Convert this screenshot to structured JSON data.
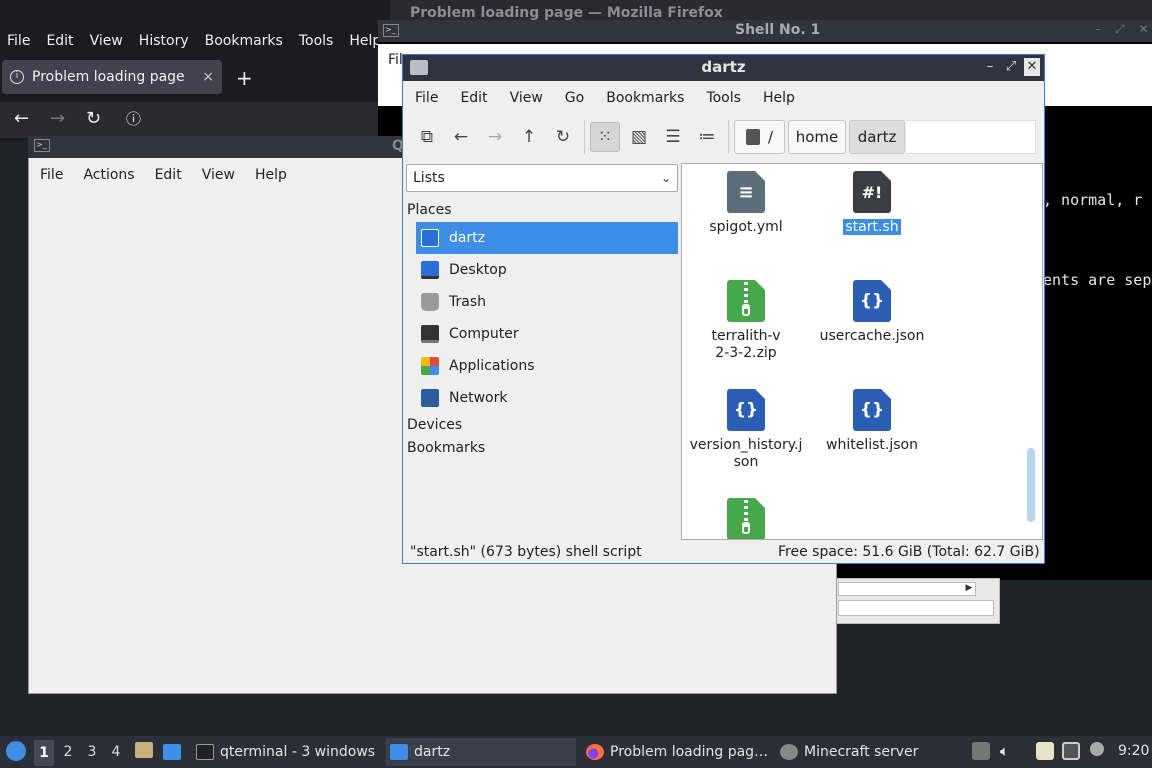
{
  "firefox": {
    "window_title": "Problem loading page — Mozilla Firefox",
    "menu": [
      "File",
      "Edit",
      "View",
      "History",
      "Bookmarks",
      "Tools",
      "Help"
    ],
    "tab_title": "Problem loading page",
    "tab_close": "×",
    "new_tab": "+"
  },
  "shell": {
    "window_title": "Shell No. 1",
    "menu_first": "Fil",
    "term_line_1": ", normal, r",
    "term_line_2": "ents are sep"
  },
  "qterminal": {
    "title_char": "Q",
    "menu": [
      "File",
      "Actions",
      "Edit",
      "View",
      "Help"
    ]
  },
  "file_manager": {
    "window_title": "dartz",
    "menu": [
      "File",
      "Edit",
      "View",
      "Go",
      "Bookmarks",
      "Tools",
      "Help"
    ],
    "breadcrumb": [
      "/",
      "home",
      "dartz"
    ],
    "side_pane_mode": "Lists",
    "places_header": "Places",
    "places": [
      {
        "label": "dartz",
        "icon": "home-folder-icon",
        "color": "#3d8ee6"
      },
      {
        "label": "Desktop",
        "icon": "desktop-icon",
        "color": "#2a6fd6"
      },
      {
        "label": "Trash",
        "icon": "trash-icon",
        "color": "#9a9a9a"
      },
      {
        "label": "Computer",
        "icon": "computer-icon",
        "color": "#333333"
      },
      {
        "label": "Applications",
        "icon": "applications-icon",
        "color": "#e64a3d"
      },
      {
        "label": "Network",
        "icon": "network-icon",
        "color": "#2d5d9e"
      }
    ],
    "devices_header": "Devices",
    "bookmarks_header": "Bookmarks",
    "files": [
      {
        "name": "spigot.yml",
        "type": "text"
      },
      {
        "name": "start.sh",
        "type": "sh",
        "selected": true
      },
      {
        "name": "terralith-v2-3-2.zip",
        "type": "zip"
      },
      {
        "name": "usercache.json",
        "type": "json"
      },
      {
        "name": "version_history.json",
        "type": "json"
      },
      {
        "name": "whitelist.json",
        "type": "json"
      },
      {
        "name": "",
        "type": "zip"
      }
    ],
    "status_left": "\"start.sh\" (673 bytes) shell script",
    "status_right": "Free space: 51.6 GiB (Total: 62.7 GiB)"
  },
  "taskbar": {
    "workspaces": [
      "1",
      "2",
      "3",
      "4"
    ],
    "tasks": [
      {
        "label": "qterminal - 3 windows"
      },
      {
        "label": "dartz"
      },
      {
        "label": "Problem loading pag…"
      },
      {
        "label": "Minecraft server"
      }
    ],
    "clock": "9:20"
  }
}
